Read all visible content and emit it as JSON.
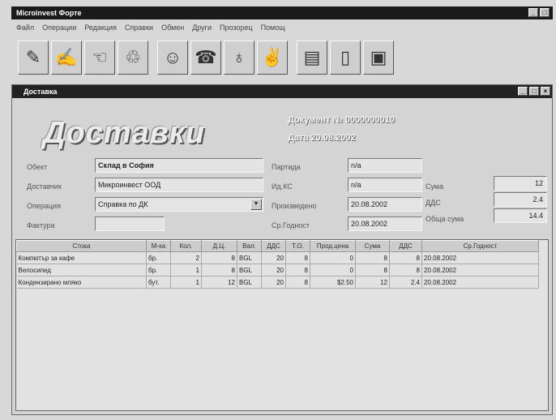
{
  "app": {
    "title": "Microinvest Форте"
  },
  "menu": [
    "Файл",
    "Операции",
    "Редакция",
    "Справки",
    "Обмен",
    "Други",
    "Прозорец",
    "Помощ"
  ],
  "toolbar": {
    "buttons": [
      {
        "name": "sales-tool",
        "glyph": "✎"
      },
      {
        "name": "delivery-tool",
        "glyph": "✍"
      },
      {
        "name": "payment-tool",
        "glyph": "☜"
      },
      {
        "name": "scrap-tool",
        "glyph": "♲"
      },
      {
        "name": "partners-tool",
        "glyph": "☺"
      },
      {
        "name": "items-tool",
        "glyph": "☎"
      },
      {
        "name": "objects-tool",
        "glyph": "♁"
      },
      {
        "name": "users-tool",
        "glyph": "✌"
      },
      {
        "name": "cashbox-tool",
        "glyph": "▤"
      },
      {
        "name": "book-tool",
        "glyph": "▯"
      },
      {
        "name": "save-tool",
        "glyph": "▣"
      }
    ]
  },
  "window": {
    "title": "Доставка",
    "heading": "Доставки",
    "doc_number": "Документ № 0000000010",
    "doc_date": "Дата 20.08.2002"
  },
  "form": {
    "object_label": "Обект",
    "object_value": "Склад в София",
    "supplier_label": "Доставчик",
    "supplier_value": "Микроинвест ООД",
    "operation_label": "Операция",
    "operation_value": "Справка по ДК",
    "invoice_label": "Фактура",
    "invoice_value": "",
    "bulstat_label": "Партида",
    "bulstat_value": "n/a",
    "vat_label": "Ид.КС",
    "vat_value": "n/a",
    "produced_label": "Произведено",
    "produced_value": "20.08.2002",
    "expiry_label": "Ср.Годност",
    "expiry_value": "20.08.2002",
    "sum_label": "Сума",
    "sum_value": "12",
    "dds_label": "ДДС",
    "dds_value": "2.4",
    "total_label": "Обща сума",
    "total_value": "14.4"
  },
  "grid": {
    "headers": [
      "Стока",
      "М-ка",
      "Кол.",
      "Д.Ц.",
      "Вал.",
      "ДДС",
      "Т.О.",
      "Прод.цена",
      "Сума",
      "ДДС",
      "Ср.Годност"
    ],
    "rows": [
      [
        "Компютър за кафе",
        "бр.",
        "2",
        "8",
        "BGL",
        "20",
        "8",
        "0",
        "8",
        "8",
        "20.08.2002"
      ],
      [
        "Велосипед",
        "бр.",
        "1",
        "8",
        "BGL",
        "20",
        "8",
        "0",
        "8",
        "8",
        "20.08.2002"
      ],
      [
        "Кондензирано мляко",
        "бут.",
        "1",
        "12",
        "BGL",
        "20",
        "8",
        "$2.50",
        "12",
        "2.4",
        "20.08.2002"
      ]
    ]
  }
}
